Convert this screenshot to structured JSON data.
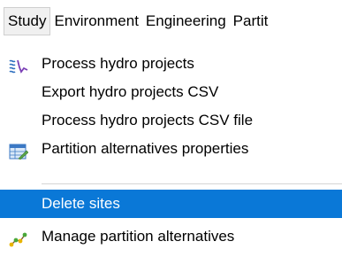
{
  "menubar": {
    "items": [
      "Study",
      "Environment",
      "Engineering",
      "Partit"
    ]
  },
  "menu": {
    "items": [
      {
        "label": "Process hydro projects",
        "icon": "hydro-chart-icon"
      },
      {
        "label": "Export hydro projects CSV"
      },
      {
        "label": "Process hydro projects CSV file"
      },
      {
        "label": "Partition alternatives properties",
        "icon": "properties-sheet-icon"
      },
      {
        "label": "Delete sites",
        "selected": true
      },
      {
        "label": "Manage partition alternatives",
        "icon": "partition-network-icon"
      }
    ]
  },
  "colors": {
    "selection": "#0a78d7",
    "separator": "#d4d4d4"
  }
}
